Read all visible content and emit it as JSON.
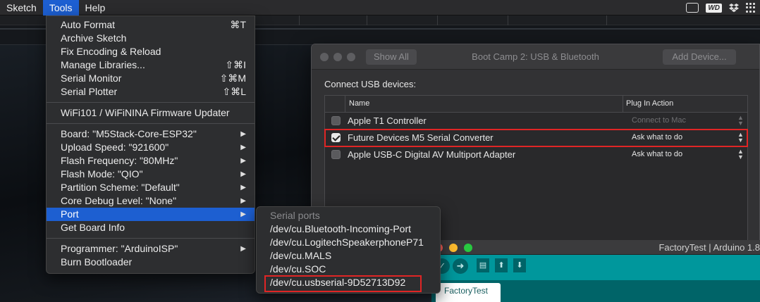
{
  "menubar": {
    "apple": "",
    "items": [
      {
        "label": "Sketch"
      },
      {
        "label": "Tools"
      },
      {
        "label": "Help"
      }
    ],
    "status_badge": "WD"
  },
  "tools_menu": {
    "items": [
      {
        "label": "Auto Format",
        "shortcut": "⌘T"
      },
      {
        "label": "Archive Sketch",
        "shortcut": ""
      },
      {
        "label": "Fix Encoding & Reload",
        "shortcut": ""
      },
      {
        "label": "Manage Libraries...",
        "shortcut": "⇧⌘I"
      },
      {
        "label": "Serial Monitor",
        "shortcut": "⇧⌘M"
      },
      {
        "label": "Serial Plotter",
        "shortcut": "⇧⌘L"
      }
    ],
    "firmware_updater": "WiFi101 / WiFiNINA Firmware Updater",
    "board_settings": [
      {
        "label": "Board: \"M5Stack-Core-ESP32\""
      },
      {
        "label": "Upload Speed: \"921600\""
      },
      {
        "label": "Flash Frequency: \"80MHz\""
      },
      {
        "label": "Flash Mode: \"QIO\""
      },
      {
        "label": "Partition Scheme: \"Default\""
      },
      {
        "label": "Core Debug Level: \"None\""
      },
      {
        "label": "Port"
      }
    ],
    "get_board_info": "Get Board Info",
    "programmer": "Programmer: \"ArduinoISP\"",
    "burn_bootloader": "Burn Bootloader",
    "highlighted": "Port"
  },
  "port_menu": {
    "header": "Serial ports",
    "ports": [
      "/dev/cu.Bluetooth-Incoming-Port",
      "/dev/cu.LogitechSpeakerphoneP71",
      "/dev/cu.MALS",
      "/dev/cu.SOC",
      "/dev/cu.usbserial-9D52713D92"
    ],
    "selected": "/dev/cu.usbserial-9D52713D92"
  },
  "bootcamp": {
    "show_all": "Show All",
    "title": "Boot Camp 2: USB & Bluetooth",
    "add_device": "Add Device...",
    "connect_label": "Connect USB devices:",
    "columns": {
      "name": "Name",
      "action": "Plug In Action"
    },
    "devices": [
      {
        "name": "Apple T1 Controller",
        "checked": false,
        "action": "Connect to Mac",
        "enabled": false
      },
      {
        "name": "Future Devices M5 Serial Converter",
        "checked": true,
        "action": "Ask what to do",
        "enabled": true
      },
      {
        "name": "Apple USB-C Digital AV Multiport Adapter",
        "checked": false,
        "action": "Ask what to do",
        "enabled": true
      }
    ]
  },
  "arduino": {
    "title": "FactoryTest | Arduino 1.8",
    "tab": "FactoryTest",
    "accent": "#00979c"
  }
}
